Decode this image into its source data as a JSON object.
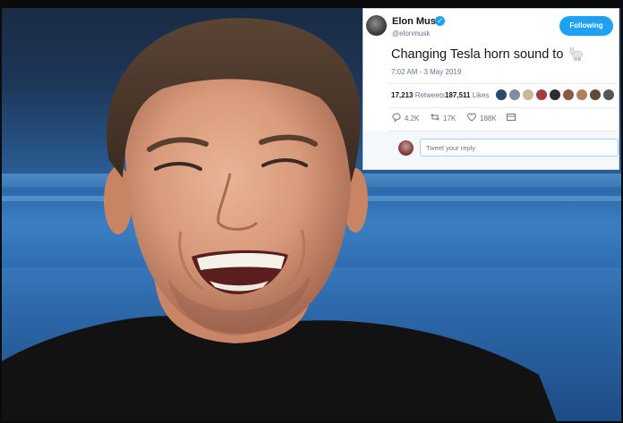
{
  "tweet": {
    "name": "Elon Musk",
    "handle": "@elonmusk",
    "follow_label": "Following",
    "text": "Changing Tesla horn sound to",
    "emoji_icon": "goat-emoji-icon",
    "timestamp": "7:02 AM - 3 May 2019",
    "retweets_count": "17,213",
    "retweets_label": "Retweets",
    "likes_count": "187,511",
    "likes_label": "Likes",
    "replies": "4.2K",
    "retweet_action": "17K",
    "likes_action": "188K",
    "reply_placeholder": "Tweet your reply",
    "verified_color": "#1da1f2"
  },
  "liker_avatars": [
    "#274b6d",
    "#7d8ea3",
    "#c9b69b",
    "#a23b3b",
    "#2d2d2d",
    "#8a5a44",
    "#b07d62",
    "#5d4b3f",
    "#555555"
  ]
}
